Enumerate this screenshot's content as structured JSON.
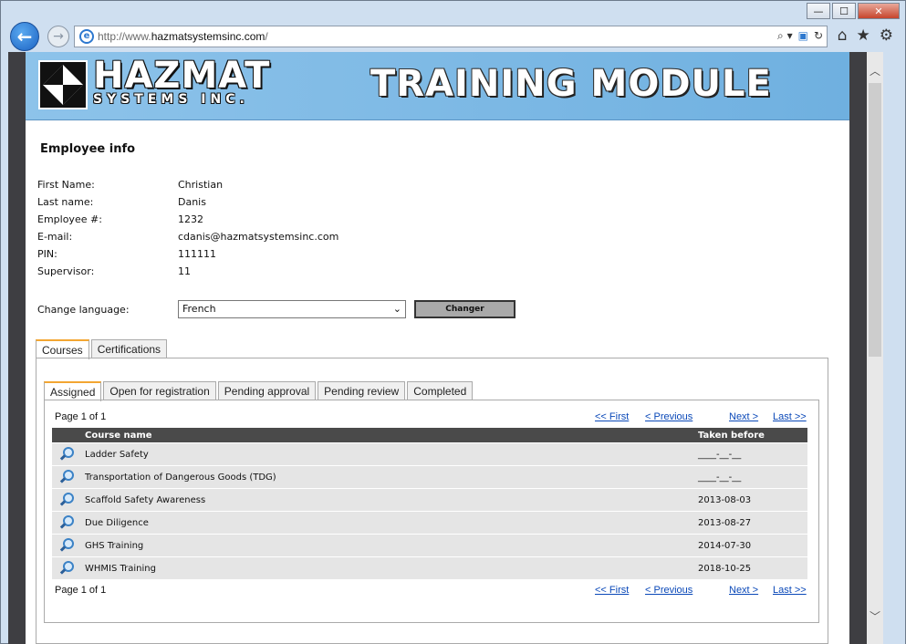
{
  "browser": {
    "url_prefix": "http://www.",
    "url_domain": "hazmatsystemsinc.com",
    "url_suffix": "/",
    "win_min": "—",
    "win_max": "☐",
    "win_close": "✕",
    "back_glyph": "←",
    "fwd_glyph": "→",
    "addr_search_glyph": "⌕ ▾",
    "addr_refresh_glyph": "↻",
    "home_glyph": "⌂",
    "fav_glyph": "★",
    "gear_glyph": "⚙",
    "scroll_up_glyph": "︿",
    "scroll_down_glyph": "﹀"
  },
  "banner": {
    "logo_text": "HAZMAT",
    "logo_sub": "SYSTEMS INC.",
    "module_title": "TRAINING MODULE"
  },
  "employee": {
    "title": "Employee info",
    "fields": [
      {
        "label": "First Name:",
        "value": "Christian"
      },
      {
        "label": "Last name:",
        "value": "Danis"
      },
      {
        "label": "Employee #:",
        "value": "1232"
      },
      {
        "label": "E-mail:",
        "value": "cdanis@hazmatsystemsinc.com"
      },
      {
        "label": "PIN:",
        "value": "111111"
      },
      {
        "label": "Supervisor:",
        "value": "11"
      }
    ]
  },
  "language": {
    "label": "Change language:",
    "selected": "French",
    "button": "Changer"
  },
  "outer_tabs": [
    "Courses",
    "Certifications"
  ],
  "inner_tabs": [
    "Assigned",
    "Open for registration",
    "Pending approval",
    "Pending review",
    "Completed"
  ],
  "pager": {
    "page_text": "Page 1 of 1",
    "first": "<< First",
    "previous": "< Previous",
    "next": "Next >",
    "last": "Last >>"
  },
  "table": {
    "headers": [
      "Course name",
      "Taken before"
    ],
    "rows": [
      {
        "course": "Ladder Safety",
        "taken": "____-__-__"
      },
      {
        "course": "Transportation of Dangerous Goods (TDG)",
        "taken": "____-__-__"
      },
      {
        "course": "Scaffold Safety Awareness",
        "taken": "2013-08-03"
      },
      {
        "course": "Due Diligence",
        "taken": "2013-08-27"
      },
      {
        "course": "GHS Training",
        "taken": "2014-07-30"
      },
      {
        "course": "WHMIS Training",
        "taken": "2018-10-25"
      }
    ]
  },
  "colors": {
    "banner": "#7ab8e6",
    "active_tab_accent": "#f3a632",
    "link": "#0a48b8",
    "table_header": "#4a4a4a"
  }
}
